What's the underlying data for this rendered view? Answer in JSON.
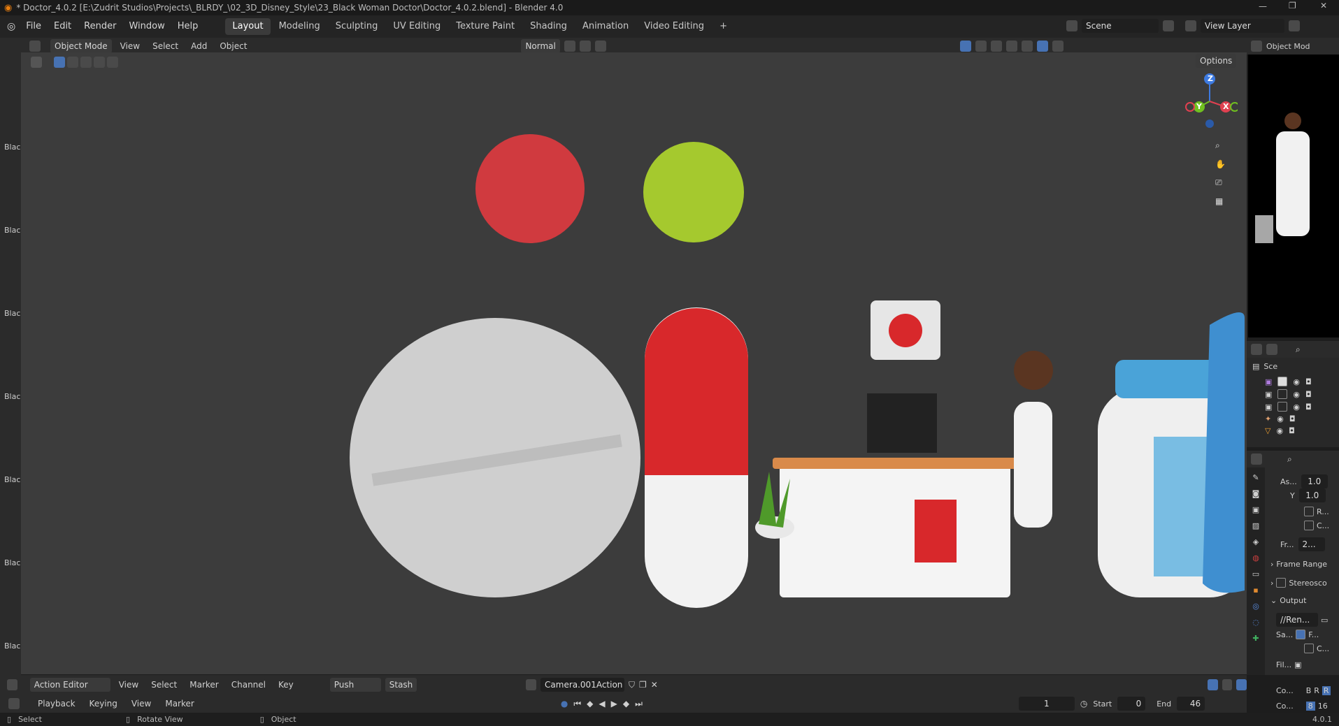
{
  "titlebar": {
    "title": "* Doctor_4.0.2 [E:\\Zudrit Studios\\Projects\\_BLRDY_\\02_3D_Disney_Style\\23_Black Woman Doctor\\Doctor_4.0.2.blend] - Blender 4.0"
  },
  "menu": [
    "File",
    "Edit",
    "Render",
    "Window",
    "Help"
  ],
  "workspaces": [
    "Layout",
    "Modeling",
    "Sculpting",
    "UV Editing",
    "Texture Paint",
    "Shading",
    "Animation",
    "Video Editing"
  ],
  "scene": {
    "name": "Scene",
    "view_layer": "View Layer"
  },
  "viewport_header": {
    "mode": "Object Mode",
    "menus": [
      "View",
      "Select",
      "Add",
      "Object"
    ],
    "orientation": "Normal",
    "options": "Options",
    "right_mode": "Object Mod"
  },
  "left_toolbar_labels": [
    "Blac",
    "Blac",
    "Blac",
    "Blac",
    "Blac",
    "Blac",
    "Blac"
  ],
  "gizmo": {
    "z": "Z",
    "y": "Y",
    "x": "X"
  },
  "outliner": {
    "root": "Sce"
  },
  "properties": {
    "aspect_label": "As...",
    "aspect_x": "1.0",
    "y_label": "Y",
    "aspect_y": "1.0",
    "render_region": "R...",
    "crop": "C...",
    "frame_rate_label": "Fr...",
    "frame_rate": "2...",
    "frame_range": "Frame Range",
    "stereoscopy": "Stereosco",
    "output": "Output",
    "output_path": "//Ren...",
    "save_label": "Sa...",
    "save_f": "F...",
    "save_c": "C...",
    "file_format_label": "Fil...",
    "color_label": "Co...",
    "color_b": "B",
    "color_r": "R",
    "color_r2": "R",
    "color_depth_label": "Co...",
    "depth_8": "8",
    "depth_16": "16"
  },
  "action_editor": {
    "mode": "Action Editor",
    "menus": [
      "View",
      "Select",
      "Marker",
      "Channel",
      "Key"
    ],
    "push_down": "Push Down",
    "stash": "Stash",
    "action_name": "Camera.001Action"
  },
  "timeline": {
    "menus": [
      "Playback",
      "Keying",
      "View",
      "Marker"
    ],
    "current_frame": "1",
    "start_label": "Start",
    "start": "0",
    "end_label": "End",
    "end": "46"
  },
  "statusbar": {
    "select": "Select",
    "rotate": "Rotate View",
    "object": "Object",
    "version": "4.0.1"
  },
  "colors": {
    "accent": "#4772b3",
    "viewport_bg": "#3c3c3c",
    "panel": "#2b2b2b"
  }
}
